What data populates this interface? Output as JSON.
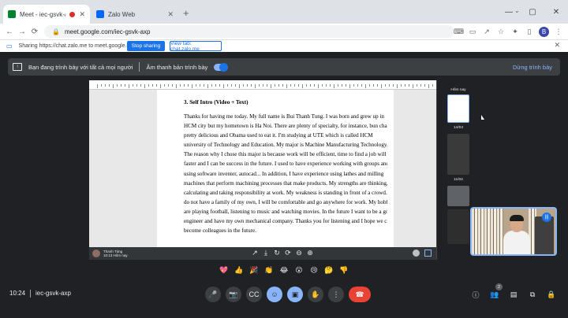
{
  "browser": {
    "tabs": [
      {
        "title": "Meet - iec-gsvk-axp",
        "favicon_color": "#00832d",
        "recording": true
      },
      {
        "title": "Zalo Web",
        "favicon_color": "#0068ff"
      }
    ],
    "new_tab": "+",
    "tablist_icon": "⌄",
    "window_controls": {
      "minimize": "—",
      "maximize": "▢",
      "close": "✕"
    },
    "url": "meet.google.com/iec-gsvk-axp",
    "nav": {
      "back": "←",
      "forward": "→",
      "reload": "⟳"
    },
    "profile_initial": "B"
  },
  "sharebar": {
    "text": "Sharing https://chat.zalo.me to meet.google.com",
    "stop_label": "Stop sharing",
    "view_label": "View tab: chat.zalo.me"
  },
  "banner": {
    "presenting_text": "Bạn đang trình bày với tất cả mọi người",
    "audio_text": "Âm thanh bản trình bày",
    "stop_label": "Dừng trình bày"
  },
  "document": {
    "title": "3. Self Intro (Video + Text)",
    "lines": [
      "Thanks for having me today. My full name is Bui Thanh Tung. I was born and grew up in",
      "HCM city but my hometown is Ha Noi. There are plenty of specialty, for instance, bun cha is",
      "pretty delicious and Obama used to eat it. I'm studying at UTE which is called HCM",
      "university of Technology and Education. My major is Machine Manufacturing Technology.",
      "The reason why I chose this major is because work will be efficient, time to find a job will be",
      "faster and I can be success in the future. I used to have experience working with groups and",
      "using software inventer, autocad... In addition, I have experience using lathes and milling",
      "machines that perform machining processes that make products. My strengths are thinking,",
      "calculating and taking responsibility at work. My weakness is standing in front of a crowd. I",
      "do not have a family of my own, I will be comfortable and go anywhere for work. My hobbies",
      "are playing football, listening to music and watching movies. In the future I want to be a good",
      "engineer and have my own mechanical company. Thanks you for listening and I hope we can",
      "become colleagues in the future."
    ]
  },
  "pdf_viewer": {
    "user_name": "Thanh Tùng",
    "user_sub": "10:13 Hôm nay",
    "tools": [
      "↗",
      "⤓",
      "↻",
      "⟳",
      "⊖",
      "⊕"
    ]
  },
  "thumbnails": {
    "label_today": "Hôm nay",
    "label_date1": "14/04",
    "label_date2": "11/04"
  },
  "reactions": [
    "💖",
    "👍",
    "🎉",
    "👏",
    "😂",
    "😮",
    "😢",
    "🤔",
    "👎"
  ],
  "meeting": {
    "time": "10:24",
    "code": "iec-gsvk-axp",
    "participant_count": "2"
  },
  "controls": {
    "mic": "🎤",
    "camera": "📷",
    "captions": "CC",
    "emoji": "☺",
    "present": "▣",
    "raise_hand": "✋",
    "more": "⋮",
    "hangup": "☎"
  },
  "right_controls": {
    "info": "ⓘ",
    "people": "👥",
    "chat": "▤",
    "activities": "⧉",
    "lock": "🔒"
  },
  "colors": {
    "accent": "#1a73e8",
    "meet_dark": "#202124",
    "hangup_red": "#ea4335"
  }
}
